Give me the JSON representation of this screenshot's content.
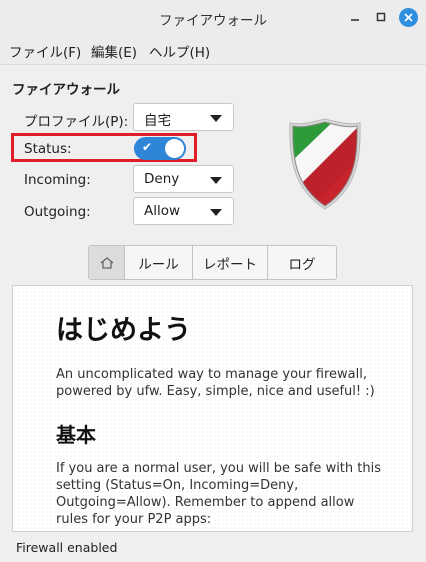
{
  "window": {
    "title": "ファイアウォール"
  },
  "menu": {
    "items": [
      "ファイル(F)",
      "編集(E)",
      "ヘルプ(H)"
    ]
  },
  "main": {
    "section_title": "ファイアウォール",
    "profile": {
      "label": "プロファイル(P):",
      "value": "自宅"
    },
    "status": {
      "label": "Status:",
      "value": "On"
    },
    "incoming": {
      "label": "Incoming:",
      "value": "Deny"
    },
    "outgoing": {
      "label": "Outgoing:",
      "value": "Allow"
    }
  },
  "tabs": {
    "items": [
      "ルール",
      "レポート",
      "ログ"
    ]
  },
  "help": {
    "heading": "はじめよう",
    "intro": "An uncomplicated way to manage your firewall, powered by ufw. Easy, simple, nice and useful! :)",
    "subheading": "基本",
    "basic": "If you are a normal user, you will be safe with this setting (Status=On, Incoming=Deny, Outgoing=Allow). Remember to append allow rules for your P2P apps:"
  },
  "statusbar": {
    "text": "Firewall enabled"
  }
}
